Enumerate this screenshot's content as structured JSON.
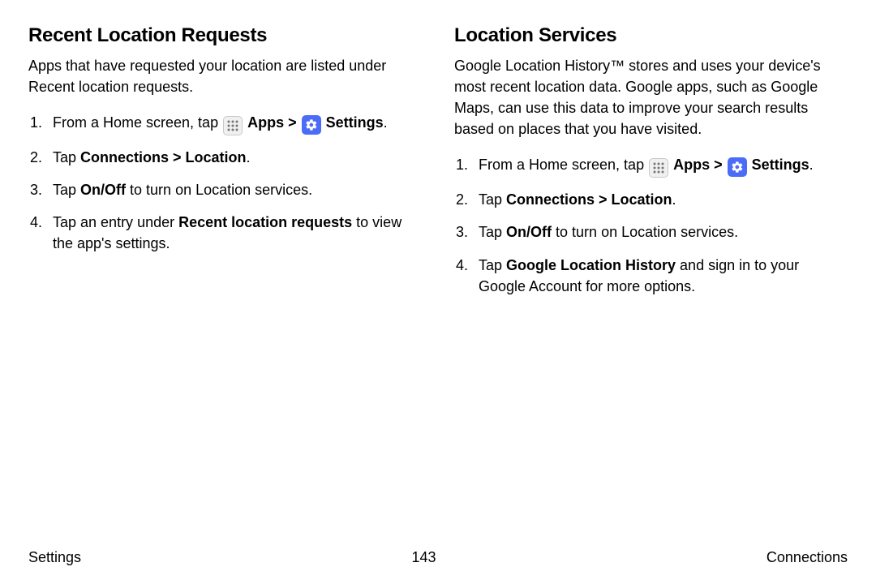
{
  "left": {
    "heading": "Recent Location Requests",
    "intro": "Apps that have requested your location are listed under Recent location requests.",
    "steps": {
      "s1_prefix": "From a Home screen, tap ",
      "s1_apps": "Apps",
      "s1_chev": " > ",
      "s1_settings": "Settings",
      "s1_suffix": ".",
      "s2_prefix": "Tap ",
      "s2_bold": "Connections > Location",
      "s2_suffix": ".",
      "s3_prefix": "Tap ",
      "s3_bold": "On/Off",
      "s3_suffix": " to turn on Location services.",
      "s4_prefix": "Tap an entry under ",
      "s4_bold": "Recent location requests",
      "s4_suffix": " to view the app's settings."
    }
  },
  "right": {
    "heading": "Location Services",
    "intro": "Google Location History™ stores and uses your device's most recent location data. Google apps, such as Google Maps, can use this data to improve your search results based on places that you have visited.",
    "steps": {
      "s1_prefix": "From a Home screen, tap ",
      "s1_apps": "Apps",
      "s1_chev": " > ",
      "s1_settings": "Settings",
      "s1_suffix": ".",
      "s2_prefix": "Tap ",
      "s2_bold": "Connections > Location",
      "s2_suffix": ".",
      "s3_prefix": "Tap ",
      "s3_bold": "On/Off",
      "s3_suffix": " to turn on Location services.",
      "s4_prefix": "Tap ",
      "s4_bold": "Google Location History",
      "s4_suffix": " and sign in to your Google Account for more options."
    }
  },
  "footer": {
    "left": "Settings",
    "center": "143",
    "right": "Connections"
  }
}
